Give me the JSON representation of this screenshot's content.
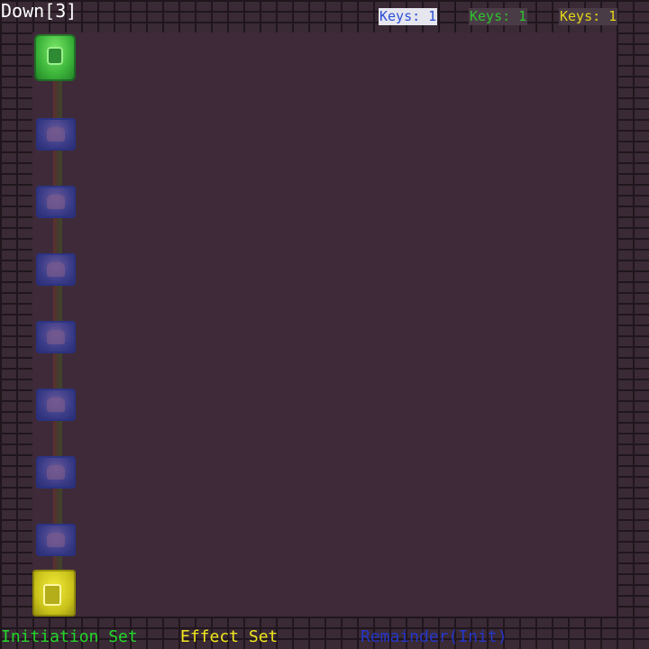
{
  "hud": {
    "mode": "Down[3]",
    "keys": [
      {
        "label": "Keys: 1",
        "color": "#2a4fd6"
      },
      {
        "label": "Keys: 1",
        "color": "#2fc42f"
      },
      {
        "label": "Keys: 1",
        "color": "#e6d61a"
      }
    ]
  },
  "legend": {
    "initiation": "Initiation Set",
    "effect": "Effect Set",
    "remainder": "Remainder(Init)"
  },
  "colors": {
    "initiation": "#22d82a",
    "effect": "#f0e81c",
    "remainder": "#2436c8",
    "floor": "#3f2a39",
    "wall": "#3a2a35"
  },
  "sprites": {
    "green_hero": "hero-sprite",
    "yellow_hero": "hero-sprite",
    "ghost_count": 8
  }
}
